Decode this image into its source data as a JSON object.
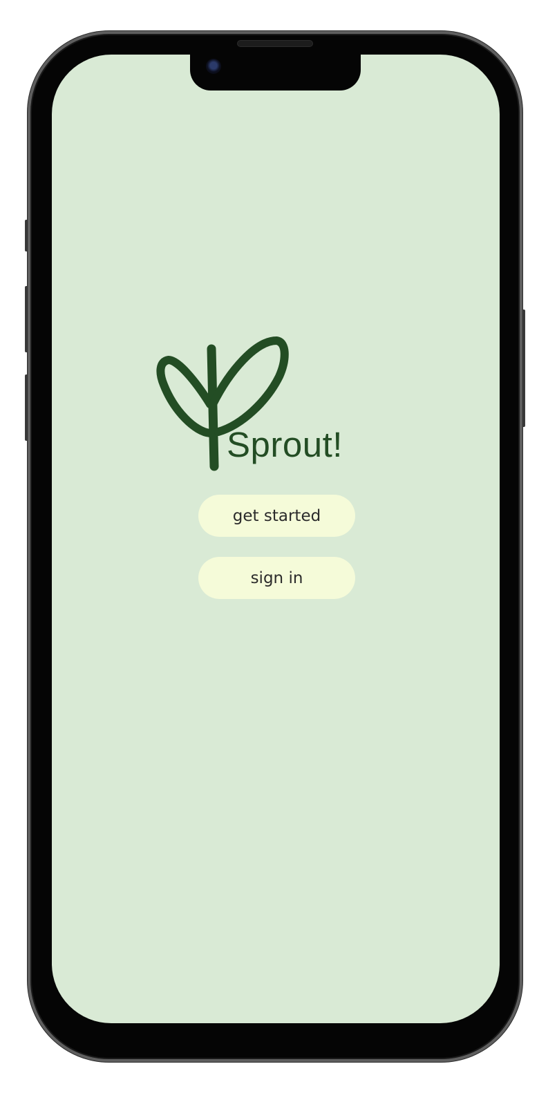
{
  "app": {
    "title": "Sprout!"
  },
  "actions": {
    "get_started_label": "get started",
    "sign_in_label": "sign in"
  },
  "icons": {
    "logo": "sprout-icon"
  },
  "colors": {
    "screen_background": "#d9ead5",
    "brand_green": "#234d24",
    "button_background": "#f5fbd9",
    "button_text": "#2b2b2b",
    "device_frame": "#050505"
  }
}
